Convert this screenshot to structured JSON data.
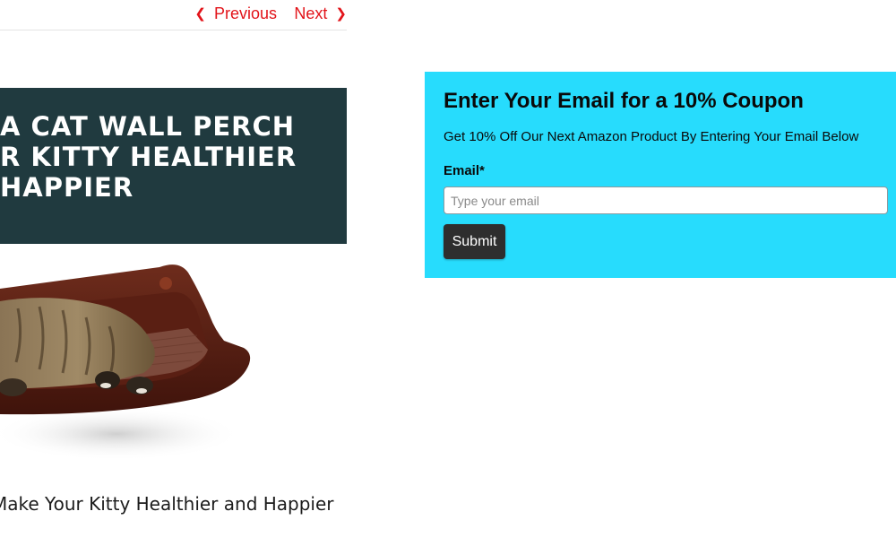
{
  "post_nav": {
    "previous_label": "Previous",
    "next_label": "Next",
    "previous_icon": "chevron-left-icon",
    "next_icon": "chevron-right-icon",
    "link_color": "#e2141a"
  },
  "banner": {
    "lines": [
      "A CAT WALL PERCH",
      "R KITTY HEALTHIER",
      "HAPPIER"
    ],
    "background": "#203a3f"
  },
  "post": {
    "title": "Make Your Kitty Healthier and Happier"
  },
  "coupon": {
    "title": "Enter Your Email for a 10% Coupon",
    "subtitle": "Get 10% Off Our Next Amazon Product By Entering Your Email Below",
    "email_label": "Email*",
    "email_placeholder": "Type your email",
    "email_value": "",
    "submit_label": "Submit",
    "background": "#27dcfd"
  }
}
